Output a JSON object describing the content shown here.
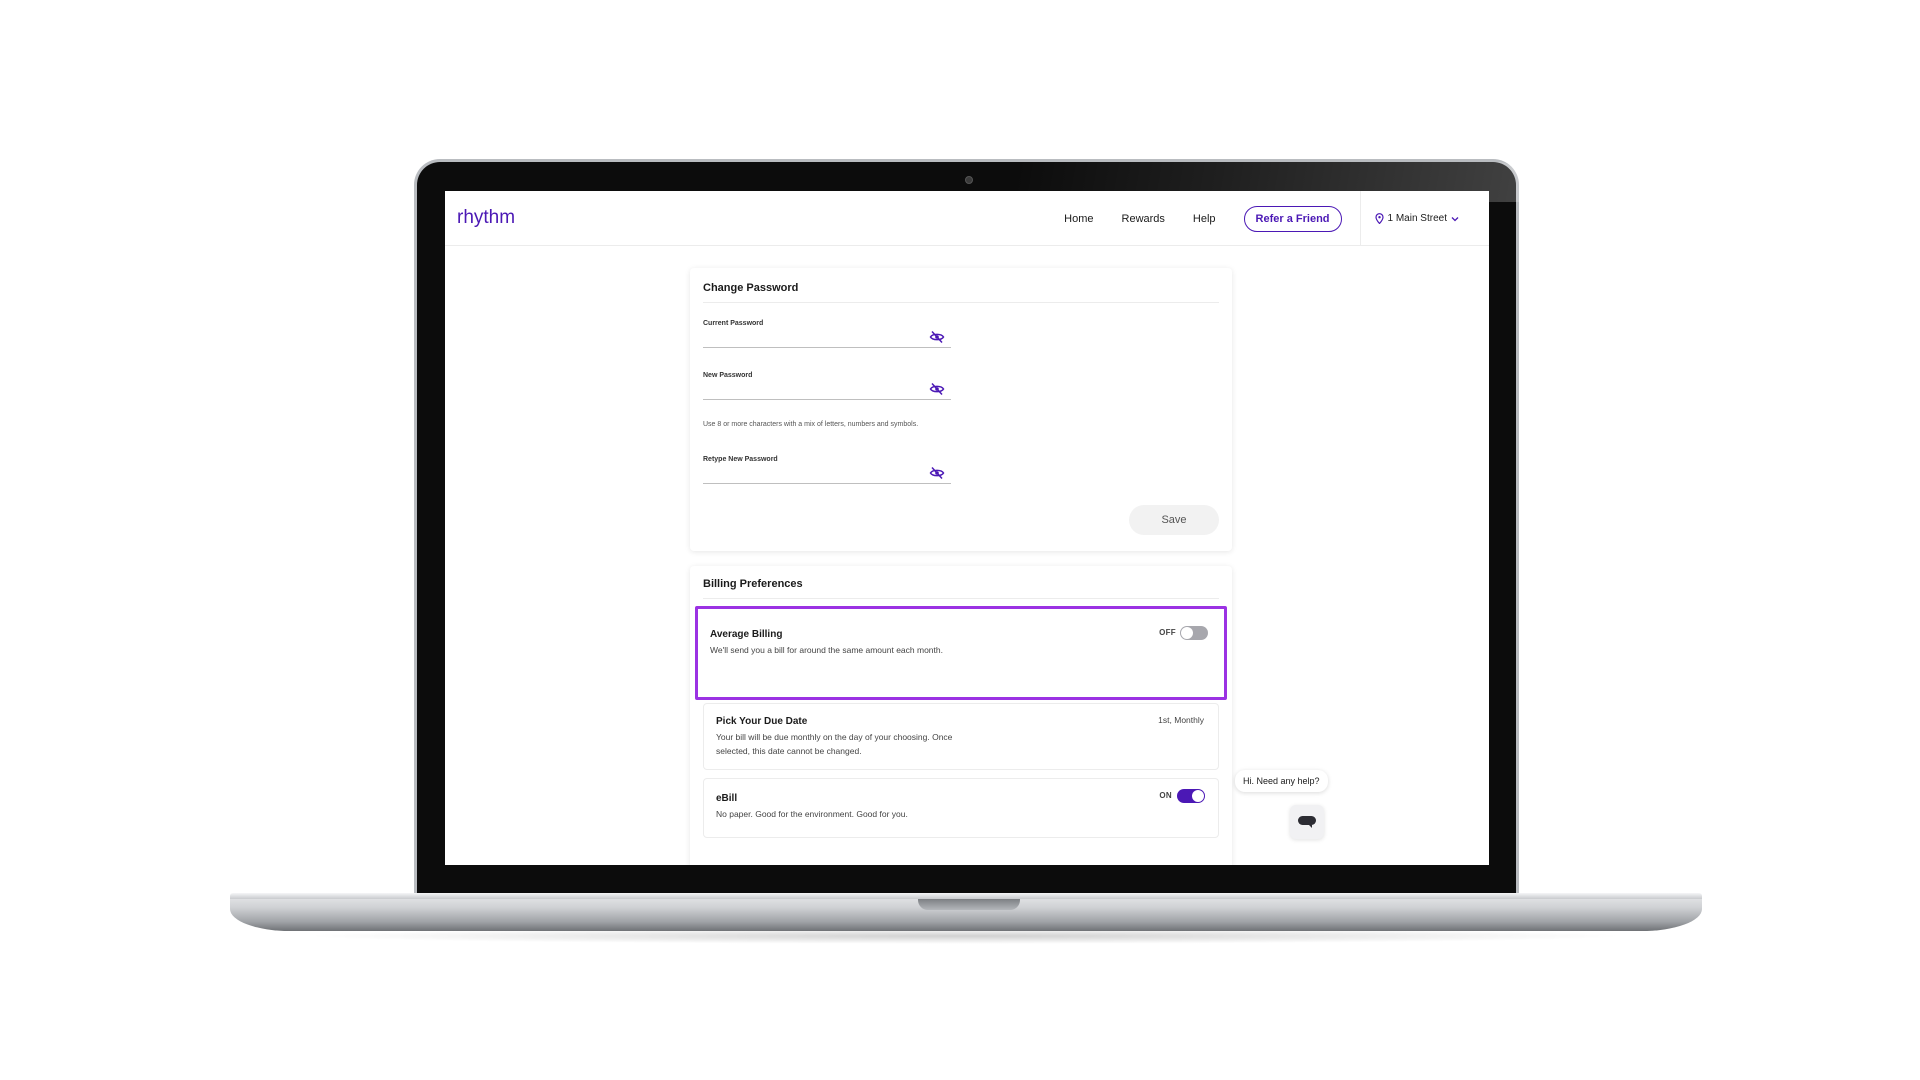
{
  "header": {
    "logo_text": "rhythm",
    "nav": [
      "Home",
      "Rewards",
      "Help"
    ],
    "refer_label": "Refer a Friend",
    "address": "1 Main Street"
  },
  "change_password": {
    "title": "Change Password",
    "current_label": "Current Password",
    "new_label": "New Password",
    "hint": "Use 8 or more characters with a mix of letters, numbers and symbols.",
    "retype_label": "Retype New Password",
    "save_label": "Save"
  },
  "billing": {
    "title": "Billing Preferences",
    "average": {
      "title": "Average Billing",
      "description": "We'll send you a bill for around the same amount each month.",
      "state_label": "OFF"
    },
    "due_date": {
      "title": "Pick Your Due Date",
      "description": "Your bill will be due monthly on the day of your choosing. Once selected, this date cannot be changed.",
      "value": "1st, Monthly"
    },
    "ebill": {
      "title": "eBill",
      "description": "No paper. Good for the environment. Good for you.",
      "state_label": "ON"
    }
  },
  "chat": {
    "prompt": "Hi. Need any help?"
  },
  "colors": {
    "brand": "#4b18b5",
    "highlight": "#9b32e3"
  }
}
